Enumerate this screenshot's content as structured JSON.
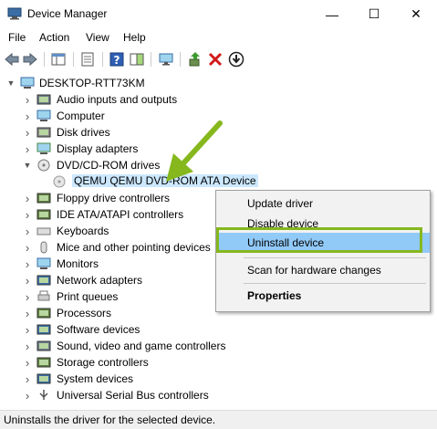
{
  "window": {
    "title": "Device Manager",
    "minimize": "—",
    "maximize": "☐",
    "close": "✕"
  },
  "menu": [
    "File",
    "Action",
    "View",
    "Help"
  ],
  "tree": {
    "root": "DESKTOP-RTT73KM",
    "items": [
      {
        "label": "Audio inputs and outputs",
        "icon": "speaker-icon"
      },
      {
        "label": "Computer",
        "icon": "computer-icon"
      },
      {
        "label": "Disk drives",
        "icon": "disk-drive-icon"
      },
      {
        "label": "Display adapters",
        "icon": "display-adapter-icon"
      },
      {
        "label": "DVD/CD-ROM drives",
        "icon": "dvd-drive-icon"
      },
      {
        "label": "QEMU QEMU DVD-ROM ATA Device",
        "icon": "dvd-device-icon"
      },
      {
        "label": "Floppy drive controllers",
        "icon": "floppy-controller-icon"
      },
      {
        "label": "IDE ATA/ATAPI controllers",
        "icon": "ide-controller-icon"
      },
      {
        "label": "Keyboards",
        "icon": "keyboard-icon"
      },
      {
        "label": "Mice and other pointing devices",
        "icon": "mouse-icon"
      },
      {
        "label": "Monitors",
        "icon": "monitor-icon"
      },
      {
        "label": "Network adapters",
        "icon": "network-adapter-icon"
      },
      {
        "label": "Print queues",
        "icon": "printer-icon"
      },
      {
        "label": "Processors",
        "icon": "processor-icon"
      },
      {
        "label": "Software devices",
        "icon": "software-device-icon"
      },
      {
        "label": "Sound, video and game controllers",
        "icon": "sound-controller-icon"
      },
      {
        "label": "Storage controllers",
        "icon": "storage-controller-icon"
      },
      {
        "label": "System devices",
        "icon": "system-device-icon"
      },
      {
        "label": "Universal Serial Bus controllers",
        "icon": "usb-icon"
      }
    ]
  },
  "context_menu": {
    "items": [
      "Update driver",
      "Disable device",
      "Uninstall device",
      "Scan for hardware changes",
      "Properties"
    ]
  },
  "status": "Uninstalls the driver for the selected device.",
  "colors": {
    "highlight": "#91c9f7",
    "annotation": "#86b81e",
    "selection": "#cce8ff"
  }
}
